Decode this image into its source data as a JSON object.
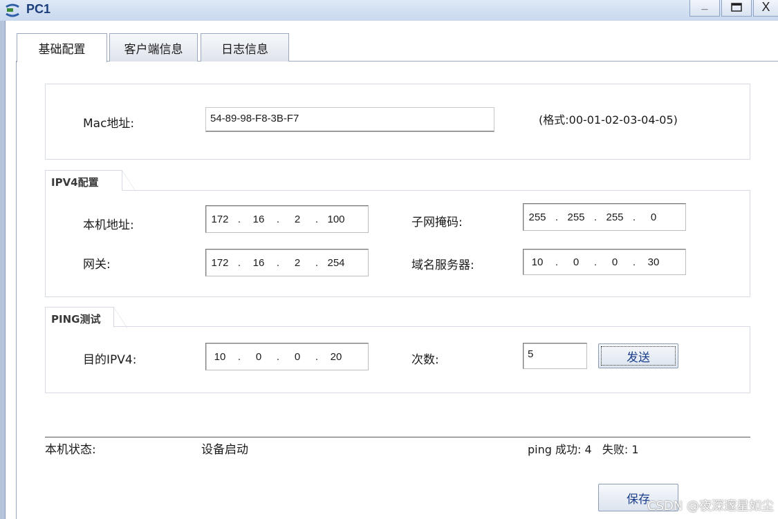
{
  "window": {
    "title": "PC1",
    "minimize": "_",
    "close": "X"
  },
  "tabs": [
    {
      "label": "基础配置",
      "active": true
    },
    {
      "label": "客户端信息",
      "active": false
    },
    {
      "label": "日志信息",
      "active": false
    }
  ],
  "mac": {
    "label": "Mac地址:",
    "value": "54-89-98-F8-3B-F7",
    "format_hint": "(格式:00-01-02-03-04-05)"
  },
  "ipv4": {
    "group_title": "IPV4配置",
    "local_address": {
      "label": "本机地址:",
      "octets": [
        "172",
        "16",
        "2",
        "100"
      ]
    },
    "subnet_mask": {
      "label": "子网掩码:",
      "octets": [
        "255",
        "255",
        "255",
        "0"
      ]
    },
    "gateway": {
      "label": "网关:",
      "octets": [
        "172",
        "16",
        "2",
        "254"
      ]
    },
    "dns": {
      "label": "域名服务器:",
      "octets": [
        "10",
        "0",
        "0",
        "30"
      ]
    }
  },
  "ping": {
    "group_title": "PING测试",
    "dest_label": "目的IPV4:",
    "dest_octets": [
      "10",
      "0",
      "0",
      "20"
    ],
    "count_label": "次数:",
    "count_value": "5",
    "send_button": "发送"
  },
  "status": {
    "label": "本机状态:",
    "value": "设备启动",
    "ping_result": "ping 成功: 4   失败: 1"
  },
  "save_button": "保存",
  "watermark": "CSDN @夜深邃星如尘",
  "colors": {
    "titlebar": "#c8d8ef",
    "title_text": "#1b3e7a",
    "button_text": "#1a3d8a"
  }
}
